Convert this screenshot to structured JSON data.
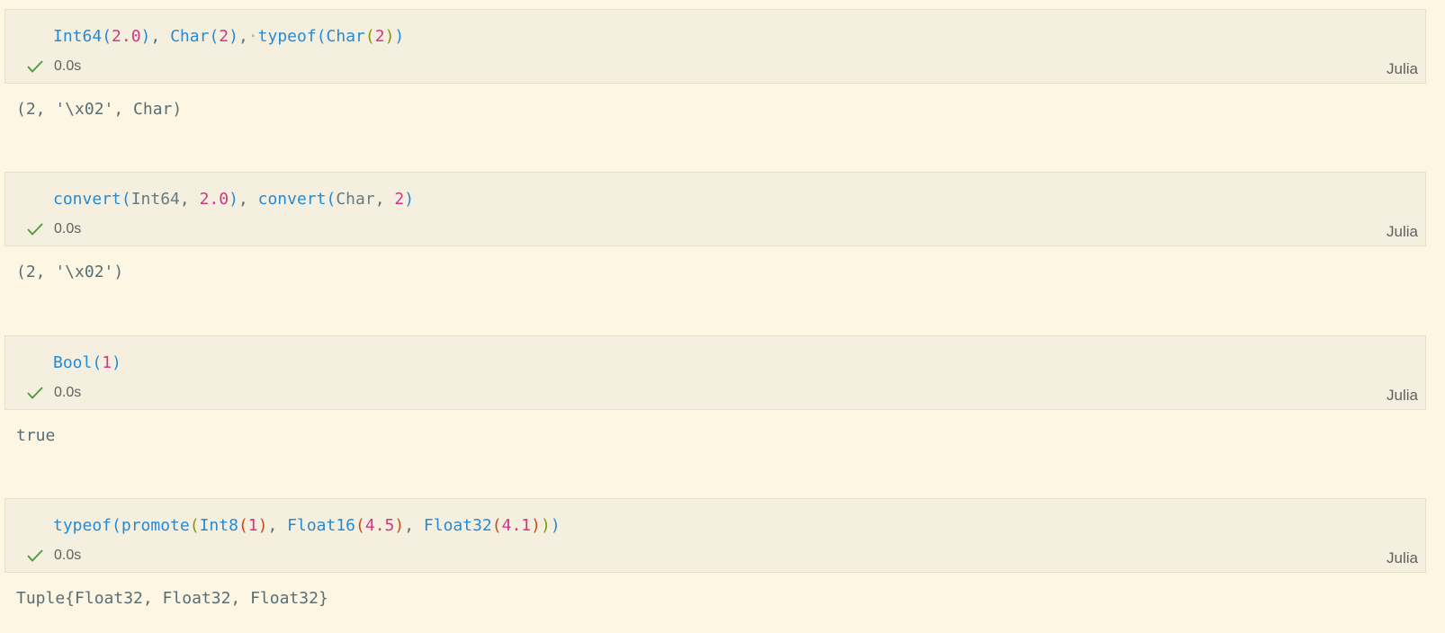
{
  "cells": [
    {
      "tokens": [
        {
          "t": "Int64",
          "c": "t-fn"
        },
        {
          "t": "(",
          "c": "b1"
        },
        {
          "t": "2.0",
          "c": "t-num"
        },
        {
          "t": ")",
          "c": "b1"
        },
        {
          "t": ", ",
          "c": "t-pun"
        },
        {
          "t": "Char",
          "c": "t-fn"
        },
        {
          "t": "(",
          "c": "b1"
        },
        {
          "t": "2",
          "c": "t-num"
        },
        {
          "t": ")",
          "c": "b1"
        },
        {
          "t": ",",
          "c": "t-pun"
        },
        {
          "t": "·",
          "c": "t-ws"
        },
        {
          "t": "typeof",
          "c": "t-fn"
        },
        {
          "t": "(",
          "c": "b1"
        },
        {
          "t": "Char",
          "c": "t-fn"
        },
        {
          "t": "(",
          "c": "b2"
        },
        {
          "t": "2",
          "c": "t-num"
        },
        {
          "t": ")",
          "c": "b2"
        },
        {
          "t": ")",
          "c": "b1"
        }
      ],
      "status_time": "0.0s",
      "language": "Julia",
      "output": "(2, '\\x02', Char)"
    },
    {
      "tokens": [
        {
          "t": "convert",
          "c": "t-fn"
        },
        {
          "t": "(",
          "c": "b1"
        },
        {
          "t": "Int64",
          "c": "t-id"
        },
        {
          "t": ", ",
          "c": "t-pun"
        },
        {
          "t": "2.0",
          "c": "t-num"
        },
        {
          "t": ")",
          "c": "b1"
        },
        {
          "t": ", ",
          "c": "t-pun"
        },
        {
          "t": "convert",
          "c": "t-fn"
        },
        {
          "t": "(",
          "c": "b1"
        },
        {
          "t": "Char",
          "c": "t-id"
        },
        {
          "t": ", ",
          "c": "t-pun"
        },
        {
          "t": "2",
          "c": "t-num"
        },
        {
          "t": ")",
          "c": "b1"
        }
      ],
      "status_time": "0.0s",
      "language": "Julia",
      "output": "(2, '\\x02')"
    },
    {
      "tokens": [
        {
          "t": "Bool",
          "c": "t-fn"
        },
        {
          "t": "(",
          "c": "b1"
        },
        {
          "t": "1",
          "c": "t-num"
        },
        {
          "t": ")",
          "c": "b1"
        }
      ],
      "status_time": "0.0s",
      "language": "Julia",
      "output": "true"
    },
    {
      "tokens": [
        {
          "t": "typeof",
          "c": "t-fn"
        },
        {
          "t": "(",
          "c": "b1"
        },
        {
          "t": "promote",
          "c": "t-fn"
        },
        {
          "t": "(",
          "c": "b2"
        },
        {
          "t": "Int8",
          "c": "t-fn"
        },
        {
          "t": "(",
          "c": "b3"
        },
        {
          "t": "1",
          "c": "t-num"
        },
        {
          "t": ")",
          "c": "b3"
        },
        {
          "t": ", ",
          "c": "t-pun"
        },
        {
          "t": "Float16",
          "c": "t-fn"
        },
        {
          "t": "(",
          "c": "b3"
        },
        {
          "t": "4.5",
          "c": "t-num"
        },
        {
          "t": ")",
          "c": "b3"
        },
        {
          "t": ", ",
          "c": "t-pun"
        },
        {
          "t": "Float32",
          "c": "t-fn"
        },
        {
          "t": "(",
          "c": "b3"
        },
        {
          "t": "4.1",
          "c": "t-num"
        },
        {
          "t": ")",
          "c": "b3"
        },
        {
          "t": ")",
          "c": "b2"
        },
        {
          "t": ")",
          "c": "b1"
        }
      ],
      "status_time": "0.0s",
      "language": "Julia",
      "output": "Tuple{Float32, Float32, Float32}"
    }
  ],
  "icons": {
    "status": "check-icon"
  },
  "colors": {
    "background": "#fdf6e3",
    "cell_background": "#f5efe0",
    "check": "#4e9a3a"
  }
}
